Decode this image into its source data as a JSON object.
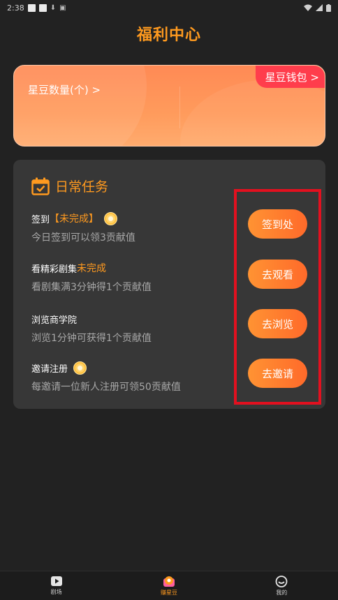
{
  "status_bar": {
    "time": "2:38"
  },
  "page": {
    "title": "福利中心"
  },
  "bean_card": {
    "bean_count_label": "星豆数量(个) >",
    "wallet_link": "星豆钱包 >"
  },
  "tasks": {
    "header": "日常任务",
    "items": [
      {
        "name": "签到",
        "status": "【未完成】",
        "has_coin": true,
        "desc": "今日签到可以领3贡献值",
        "button": "签到处"
      },
      {
        "name": "看精彩剧集",
        "status": "未完成",
        "has_coin": false,
        "desc": "看剧集满3分钟得1个贡献值",
        "button": "去观看"
      },
      {
        "name": "浏览商学院",
        "status": "",
        "has_coin": false,
        "desc": "浏览1分钟可获得1个贡献值",
        "button": "去浏览"
      },
      {
        "name": "邀请注册",
        "status": "",
        "has_coin": true,
        "desc": "每邀请一位新人注册可领50贡献值",
        "button": "去邀请"
      }
    ]
  },
  "nav": {
    "items": [
      {
        "label": "剧场",
        "icon": "play-icon"
      },
      {
        "label": "赚星豆",
        "icon": "star-bean-icon"
      },
      {
        "label": "我的",
        "icon": "smile-icon"
      }
    ]
  },
  "colors": {
    "accent": "#ff9a1f",
    "highlight_box": "#e3101f",
    "wallet_tag": "#ff3d4c"
  }
}
